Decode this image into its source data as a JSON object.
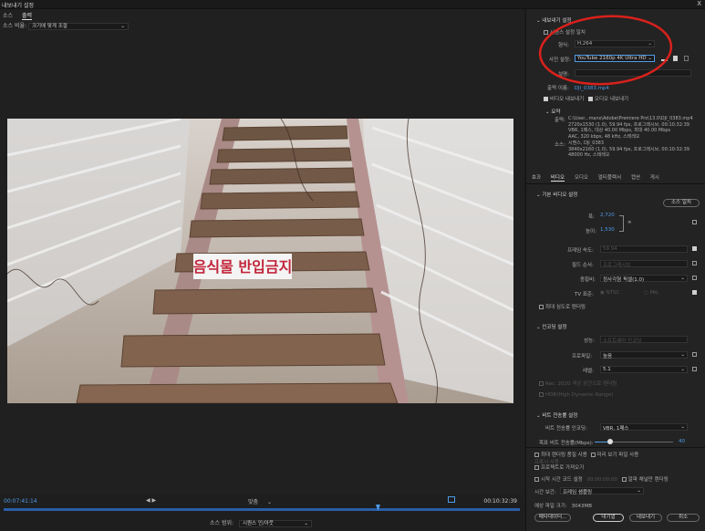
{
  "window": {
    "title": "내보내기 설정",
    "close": "X"
  },
  "source_tabs": [
    "소스",
    "출력"
  ],
  "source_scale": {
    "label": "소스 비율:",
    "value": "크기에 맞게 조절"
  },
  "sign_text": "음식물 반입금지",
  "timeline": {
    "current_time": "00:07:41:14",
    "end_time": "00:10:32:39",
    "fit": "맞춤",
    "source_range_label": "소스 범위:",
    "source_range_value": "시퀀스 인/아웃"
  },
  "export": {
    "section_title": "내보내기 설정",
    "match_sequence": "시퀀스 설정 일치",
    "format_label": "형식:",
    "format_value": "H.264",
    "preset_label": "사전 설정:",
    "preset_value": "YouTube 2160p 4K Ultra HD",
    "comment_label": "설명:",
    "output_name_label": "출력 이름:",
    "output_name_value": "DJI_0383.mp4",
    "export_video": "비디오 내보내기",
    "export_audio": "오디오 내보내기"
  },
  "summary": {
    "title": "요약",
    "output_label": "출력:",
    "output_lines": [
      "C:\\User...mans\\Adobe\\Premiere Pro\\13.0\\DJI_0383.mp4",
      "2720x1530 (1.0), 59.94 fps, 프로그레시브, 00:10:32:39",
      "VBR, 1패스, 대상 40.00 Mbps, 최대 40.00 Mbps",
      "AAC, 320 kbps, 48 kHz, 스테레오"
    ],
    "source_label": "소스:",
    "source_lines": [
      "시퀀스, DJI_0383",
      "3840x2160 (1.0), 59.94 fps, 프로그레시브, 00:10:32:39",
      "48000 Hz, 스테레오"
    ]
  },
  "tabs": [
    "효과",
    "비디오",
    "오디오",
    "멀티플렉서",
    "캡션",
    "게시"
  ],
  "video": {
    "basic_title": "기본 비디오 설정",
    "match_source": "소스 일치",
    "width_label": "폭:",
    "width_value": "2,720",
    "height_label": "높이:",
    "height_value": "1,530",
    "frame_rate_label": "프레임 속도:",
    "frame_rate_value": "59.94",
    "field_order_label": "필드 순서:",
    "field_order_value": "프로그레시브",
    "aspect_label": "종횡비:",
    "aspect_value": "정사각형 픽셀(1.0)",
    "tv_label": "TV 표준:",
    "tv_ntsc": "NTSC",
    "tv_pal": "PAL",
    "max_depth": "최대 심도로 렌더링"
  },
  "encoding": {
    "title": "인코딩 설정",
    "perf_label": "성능:",
    "perf_value": "소프트웨어 인코딩",
    "profile_label": "프로파일:",
    "profile_value": "높음",
    "level_label": "레벨:",
    "level_value": "5.1",
    "rec2020": "Rec. 2020 색상 공간으로 렌더링",
    "hdr": "HDR(High Dynamic Range)"
  },
  "bitrate": {
    "title": "비트 전송률 설정",
    "encoding_label": "비트 전송률 인코딩:",
    "encoding_value": "VBR, 1패스",
    "target_label": "목표 비트 전송률(Mbps):",
    "target_value": "40"
  },
  "footer": {
    "max_quality": "최대 렌더링 품질 사용",
    "use_previews": "미리 보기 파일 사용",
    "proxy": "프록시 사용",
    "import": "프로젝트로 가져오기",
    "set_start_tc": "시작 시간 코드 설정",
    "start_tc_value": "00:00:00:00",
    "alpha_only": "알파 채널만 렌더링",
    "interp_label": "시간 보간:",
    "interp_value": "프레임 샘플링",
    "file_size_label": "예상 파일 크기:",
    "file_size_value": "3043MB",
    "metadata": "메타데이터...",
    "queue": "대기열",
    "export": "내보내기",
    "cancel": "취소"
  },
  "colors": {
    "accent": "#4f9be8",
    "annotation": "#d9211c",
    "panel": "#232323"
  }
}
